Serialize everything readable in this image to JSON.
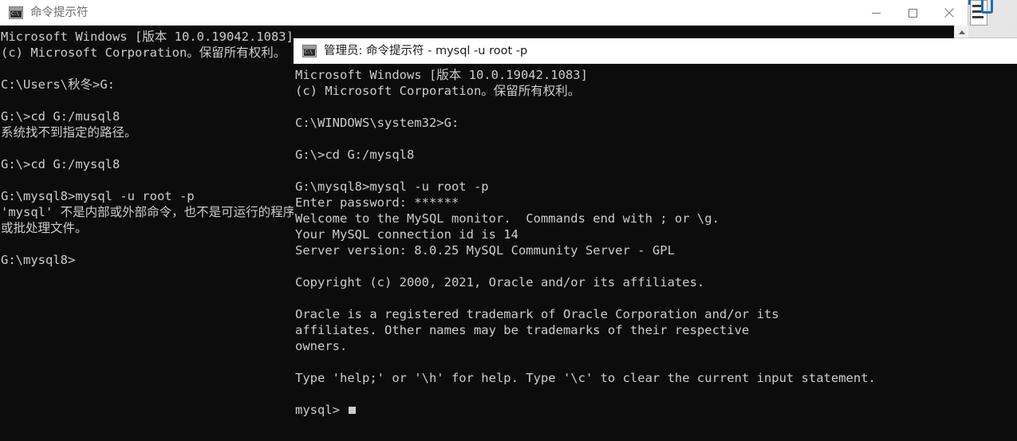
{
  "desktop": {
    "icon_name": "document-shortcut-icon"
  },
  "left_window": {
    "title": "命令提示符",
    "icon_glyph": "C:\\",
    "controls": {
      "minimize": "minimize-icon",
      "maximize": "maximize-icon",
      "close": "close-icon"
    },
    "lines": [
      "Microsoft Windows [版本 10.0.19042.1083]",
      "(c) Microsoft Corporation。保留所有权利。",
      "",
      "C:\\Users\\秋冬>G:",
      "",
      "G:\\>cd G:/musql8",
      "系统找不到指定的路径。",
      "",
      "G:\\>cd G:/mysql8",
      "",
      "G:\\mysql8>mysql -u root -p",
      "'mysql' 不是内部或外部命令，也不是可运行的程序",
      "或批处理文件。",
      "",
      "G:\\mysql8>"
    ]
  },
  "right_window": {
    "title": "管理员: 命令提示符 - mysql  -u root -p",
    "icon_glyph": "C:\\",
    "lines": [
      "Microsoft Windows [版本 10.0.19042.1083]",
      "(c) Microsoft Corporation。保留所有权利。",
      "",
      "C:\\WINDOWS\\system32>G:",
      "",
      "G:\\>cd G:/mysql8",
      "",
      "G:\\mysql8>mysql -u root -p",
      "Enter password: ******",
      "Welcome to the MySQL monitor.  Commands end with ; or \\g.",
      "Your MySQL connection id is 14",
      "Server version: 8.0.25 MySQL Community Server - GPL",
      "",
      "Copyright (c) 2000, 2021, Oracle and/or its affiliates.",
      "",
      "Oracle is a registered trademark of Oracle Corporation and/or its",
      "affiliates. Other names may be trademarks of their respective",
      "owners.",
      "",
      "Type 'help;' or '\\h' for help. Type '\\c' to clear the current input statement.",
      "",
      "mysql> "
    ],
    "prompt": "mysql>",
    "cursor": "text-cursor"
  },
  "colors": {
    "terminal_bg": "#0c0c0c",
    "terminal_fg": "#cccccc",
    "titlebar_bg": "#ffffff",
    "title_inactive": "#6e6e6e",
    "title_active": "#1a1a1a"
  }
}
